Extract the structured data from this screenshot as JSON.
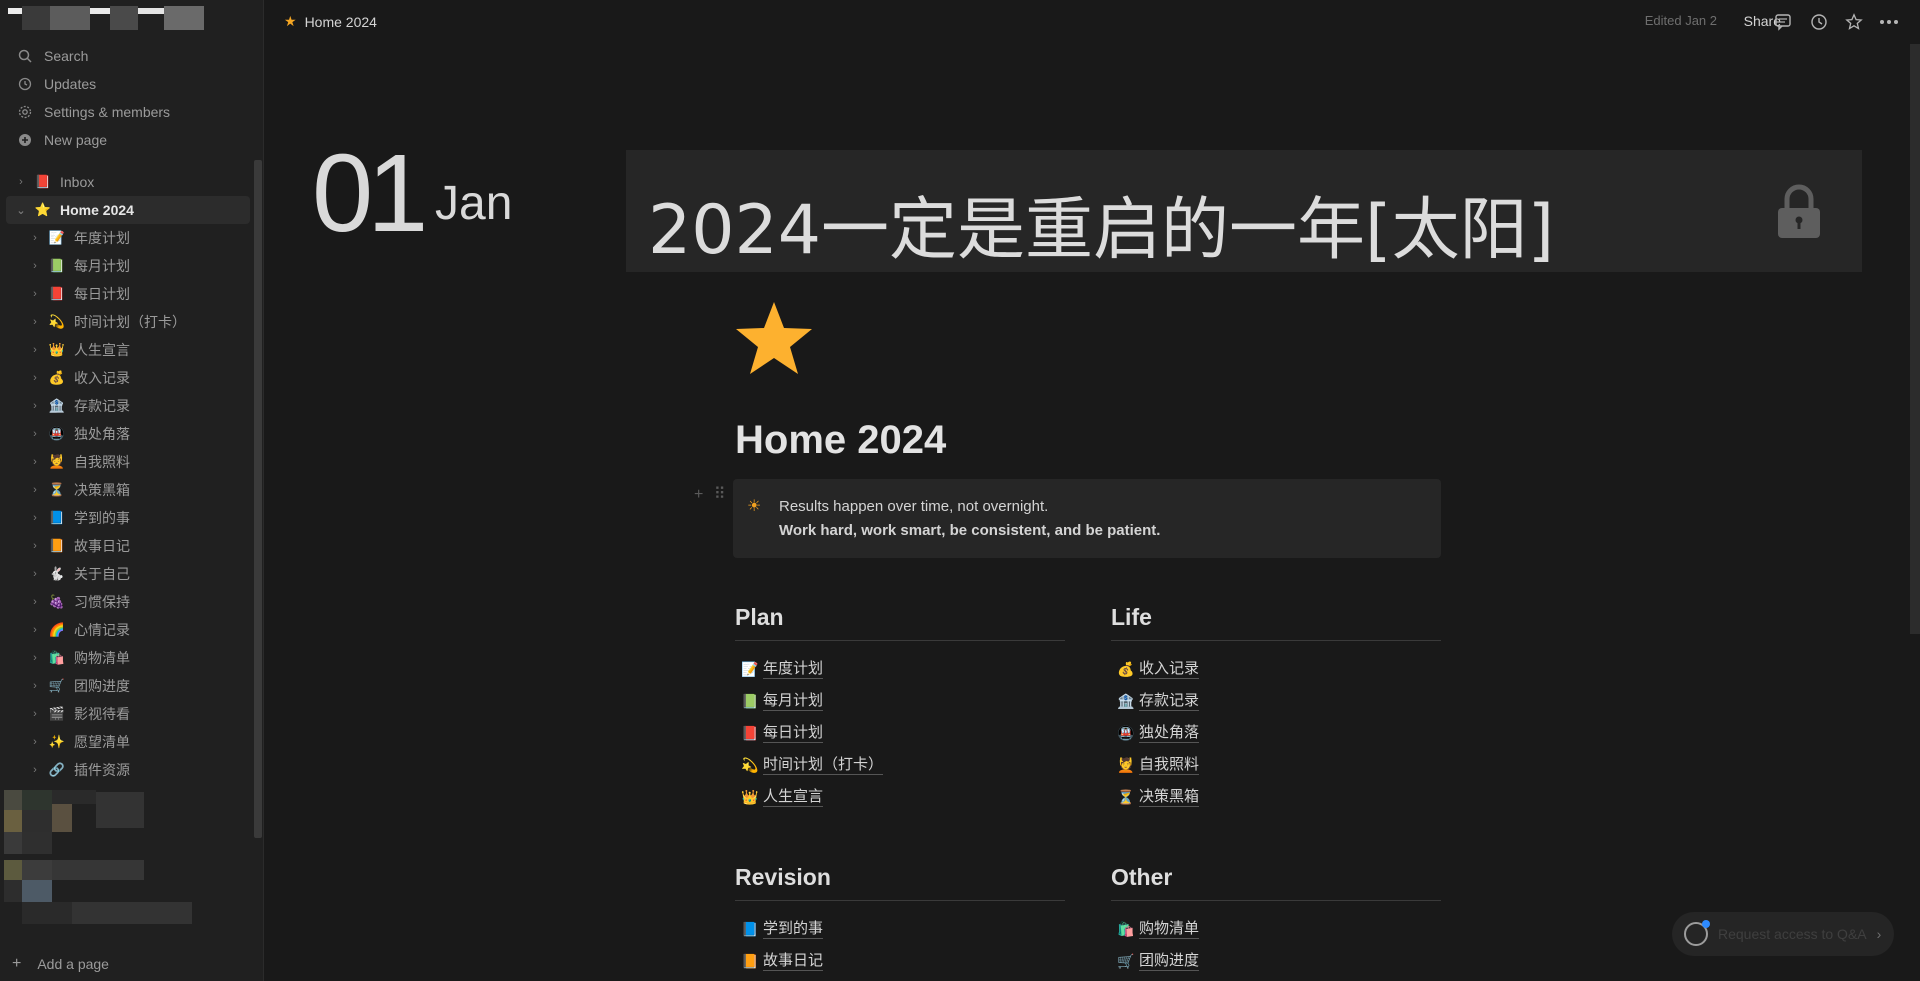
{
  "sidebar": {
    "nav": [
      {
        "label": "Search",
        "icon": "search-icon"
      },
      {
        "label": "Updates",
        "icon": "clock-icon"
      },
      {
        "label": "Settings & members",
        "icon": "gear-icon"
      },
      {
        "label": "New page",
        "icon": "plus-circle-icon"
      }
    ],
    "inbox": {
      "label": "Inbox",
      "emoji": "📕"
    },
    "home": {
      "label": "Home 2024",
      "emoji": "⭐"
    },
    "children": [
      {
        "label": "年度计划",
        "emoji": "📝"
      },
      {
        "label": "每月计划",
        "emoji": "📗"
      },
      {
        "label": "每日计划",
        "emoji": "📕"
      },
      {
        "label": "时间计划（打卡）",
        "emoji": "💫"
      },
      {
        "label": "人生宣言",
        "emoji": "👑"
      },
      {
        "label": "收入记录",
        "emoji": "💰"
      },
      {
        "label": "存款记录",
        "emoji": "🏦"
      },
      {
        "label": "独处角落",
        "emoji": "🚇"
      },
      {
        "label": "自我照料",
        "emoji": "💆"
      },
      {
        "label": "决策黑箱",
        "emoji": "⏳"
      },
      {
        "label": "学到的事",
        "emoji": "📘"
      },
      {
        "label": "故事日记",
        "emoji": "📙"
      },
      {
        "label": "关于自己",
        "emoji": "🐇"
      },
      {
        "label": "习惯保持",
        "emoji": "🍇"
      },
      {
        "label": "心情记录",
        "emoji": "🌈"
      },
      {
        "label": "购物清单",
        "emoji": "🛍️"
      },
      {
        "label": "团购进度",
        "emoji": "🛒"
      },
      {
        "label": "影视待看",
        "emoji": "🎬"
      },
      {
        "label": "愿望清单",
        "emoji": "✨"
      },
      {
        "label": "插件资源",
        "emoji": "🔗"
      }
    ],
    "add_page": "Add a page"
  },
  "topbar": {
    "breadcrumb": "Home 2024",
    "edited": "Edited Jan 2",
    "share": "Share"
  },
  "header": {
    "day": "01",
    "month": "Jan",
    "banner": "2024一定是重启的一年[太阳]"
  },
  "page": {
    "title": "Home 2024",
    "callout_line1": "Results happen over time, not overnight.",
    "callout_line2": "Work hard, work smart, be consistent, and be patient."
  },
  "sections": [
    {
      "title": "Plan",
      "links": [
        {
          "label": "年度计划",
          "emoji": "📝"
        },
        {
          "label": "每月计划",
          "emoji": "📗"
        },
        {
          "label": "每日计划",
          "emoji": "📕"
        },
        {
          "label": "时间计划（打卡）",
          "emoji": "💫"
        },
        {
          "label": "人生宣言",
          "emoji": "👑"
        }
      ]
    },
    {
      "title": "Life",
      "links": [
        {
          "label": "收入记录",
          "emoji": "💰"
        },
        {
          "label": "存款记录",
          "emoji": "🏦"
        },
        {
          "label": "独处角落",
          "emoji": "🚇"
        },
        {
          "label": "自我照料",
          "emoji": "💆"
        },
        {
          "label": "决策黑箱",
          "emoji": "⏳"
        }
      ]
    },
    {
      "title": "Revision",
      "links": [
        {
          "label": "学到的事",
          "emoji": "📘"
        },
        {
          "label": "故事日记",
          "emoji": "📙"
        }
      ]
    },
    {
      "title": "Other",
      "links": [
        {
          "label": "购物清单",
          "emoji": "🛍️"
        },
        {
          "label": "团购进度",
          "emoji": "🛒"
        }
      ]
    }
  ],
  "qa_button": "Request access to Q&A"
}
